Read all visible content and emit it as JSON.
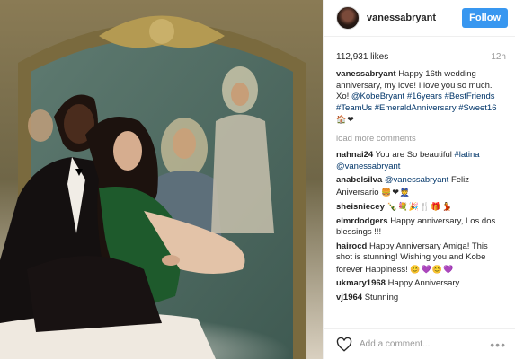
{
  "user": {
    "name": "vanessabryant",
    "follow_label": "Follow"
  },
  "post": {
    "likes": "112,931 likes",
    "time": "12h",
    "caption": {
      "user": "vanessabryant",
      "text": "Happy 16th wedding anniversary, my love! I love you so much. Xo!",
      "mention": "@KobeBryant",
      "tags1": "#16years",
      "tags2": "#BestFriends #TeamUs",
      "tags3": "#EmeraldAnniversary #Sweet16",
      "emojis": "🏠❤"
    },
    "load_more": "load more comments"
  },
  "comments": [
    {
      "user": "nahnai24",
      "text": "You are So beautiful",
      "tag": "#latina",
      "mention": "@vanessabryant"
    },
    {
      "user": "anabelsilva",
      "mention": "@vanessabryant",
      "text": "Feliz Aniversario",
      "emojis": "🍔❤👮"
    },
    {
      "user": "sheisniecey",
      "emojis": "🍾💐🎉🍴🎁💃"
    },
    {
      "user": "elmrdodgers",
      "text": "Happy anniversary, Los dos blessings !!!"
    },
    {
      "user": "hairocd",
      "text": "Happy Anniversary Amiga! This shot is stunning! Wishing you and Kobe forever Happiness!",
      "emojis": "😊💜😊💜"
    },
    {
      "user": "ukmary1968",
      "text": "Happy Anniversary"
    },
    {
      "user": "vj1964",
      "text": "Stunning"
    }
  ],
  "footer": {
    "placeholder": "Add a comment...",
    "more": "•••"
  },
  "colors": {
    "accent": "#3897f0",
    "link": "#003569",
    "muted": "#999999"
  },
  "icons": {
    "like": "heart-icon",
    "options": "more-options-icon"
  }
}
